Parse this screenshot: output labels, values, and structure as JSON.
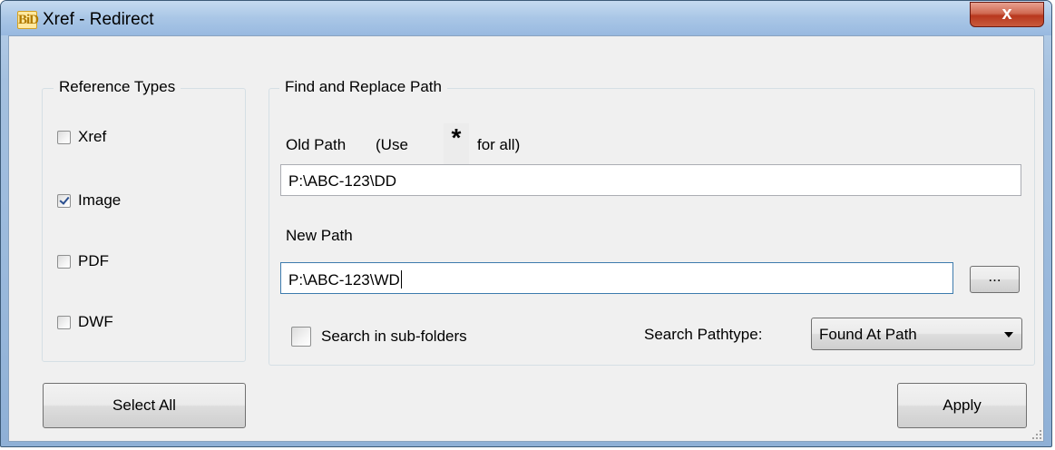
{
  "window": {
    "icon_text": "BiD",
    "title": "Xref - Redirect",
    "close_label": "x"
  },
  "reference_types": {
    "title": "Reference Types",
    "items": [
      {
        "label": "Xref",
        "checked": false
      },
      {
        "label": "Image",
        "checked": true
      },
      {
        "label": "PDF",
        "checked": false
      },
      {
        "label": "DWF",
        "checked": false
      }
    ]
  },
  "find_replace": {
    "title": "Find and Replace Path",
    "old_path_label": "Old Path",
    "old_path_hint_prefix": "(Use",
    "old_path_hint_star": "*",
    "old_path_hint_suffix": "for all)",
    "old_path_value": "P:\\ABC-123\\DD",
    "new_path_label": "New Path",
    "new_path_value": "P:\\ABC-123\\WD",
    "browse_label": "...",
    "search_subfolders_label": "Search in sub-folders",
    "search_subfolders_checked": false,
    "search_pathtype_label": "Search Pathtype:",
    "search_pathtype_value": "Found At Path"
  },
  "buttons": {
    "select_all": "Select All",
    "apply": "Apply"
  }
}
